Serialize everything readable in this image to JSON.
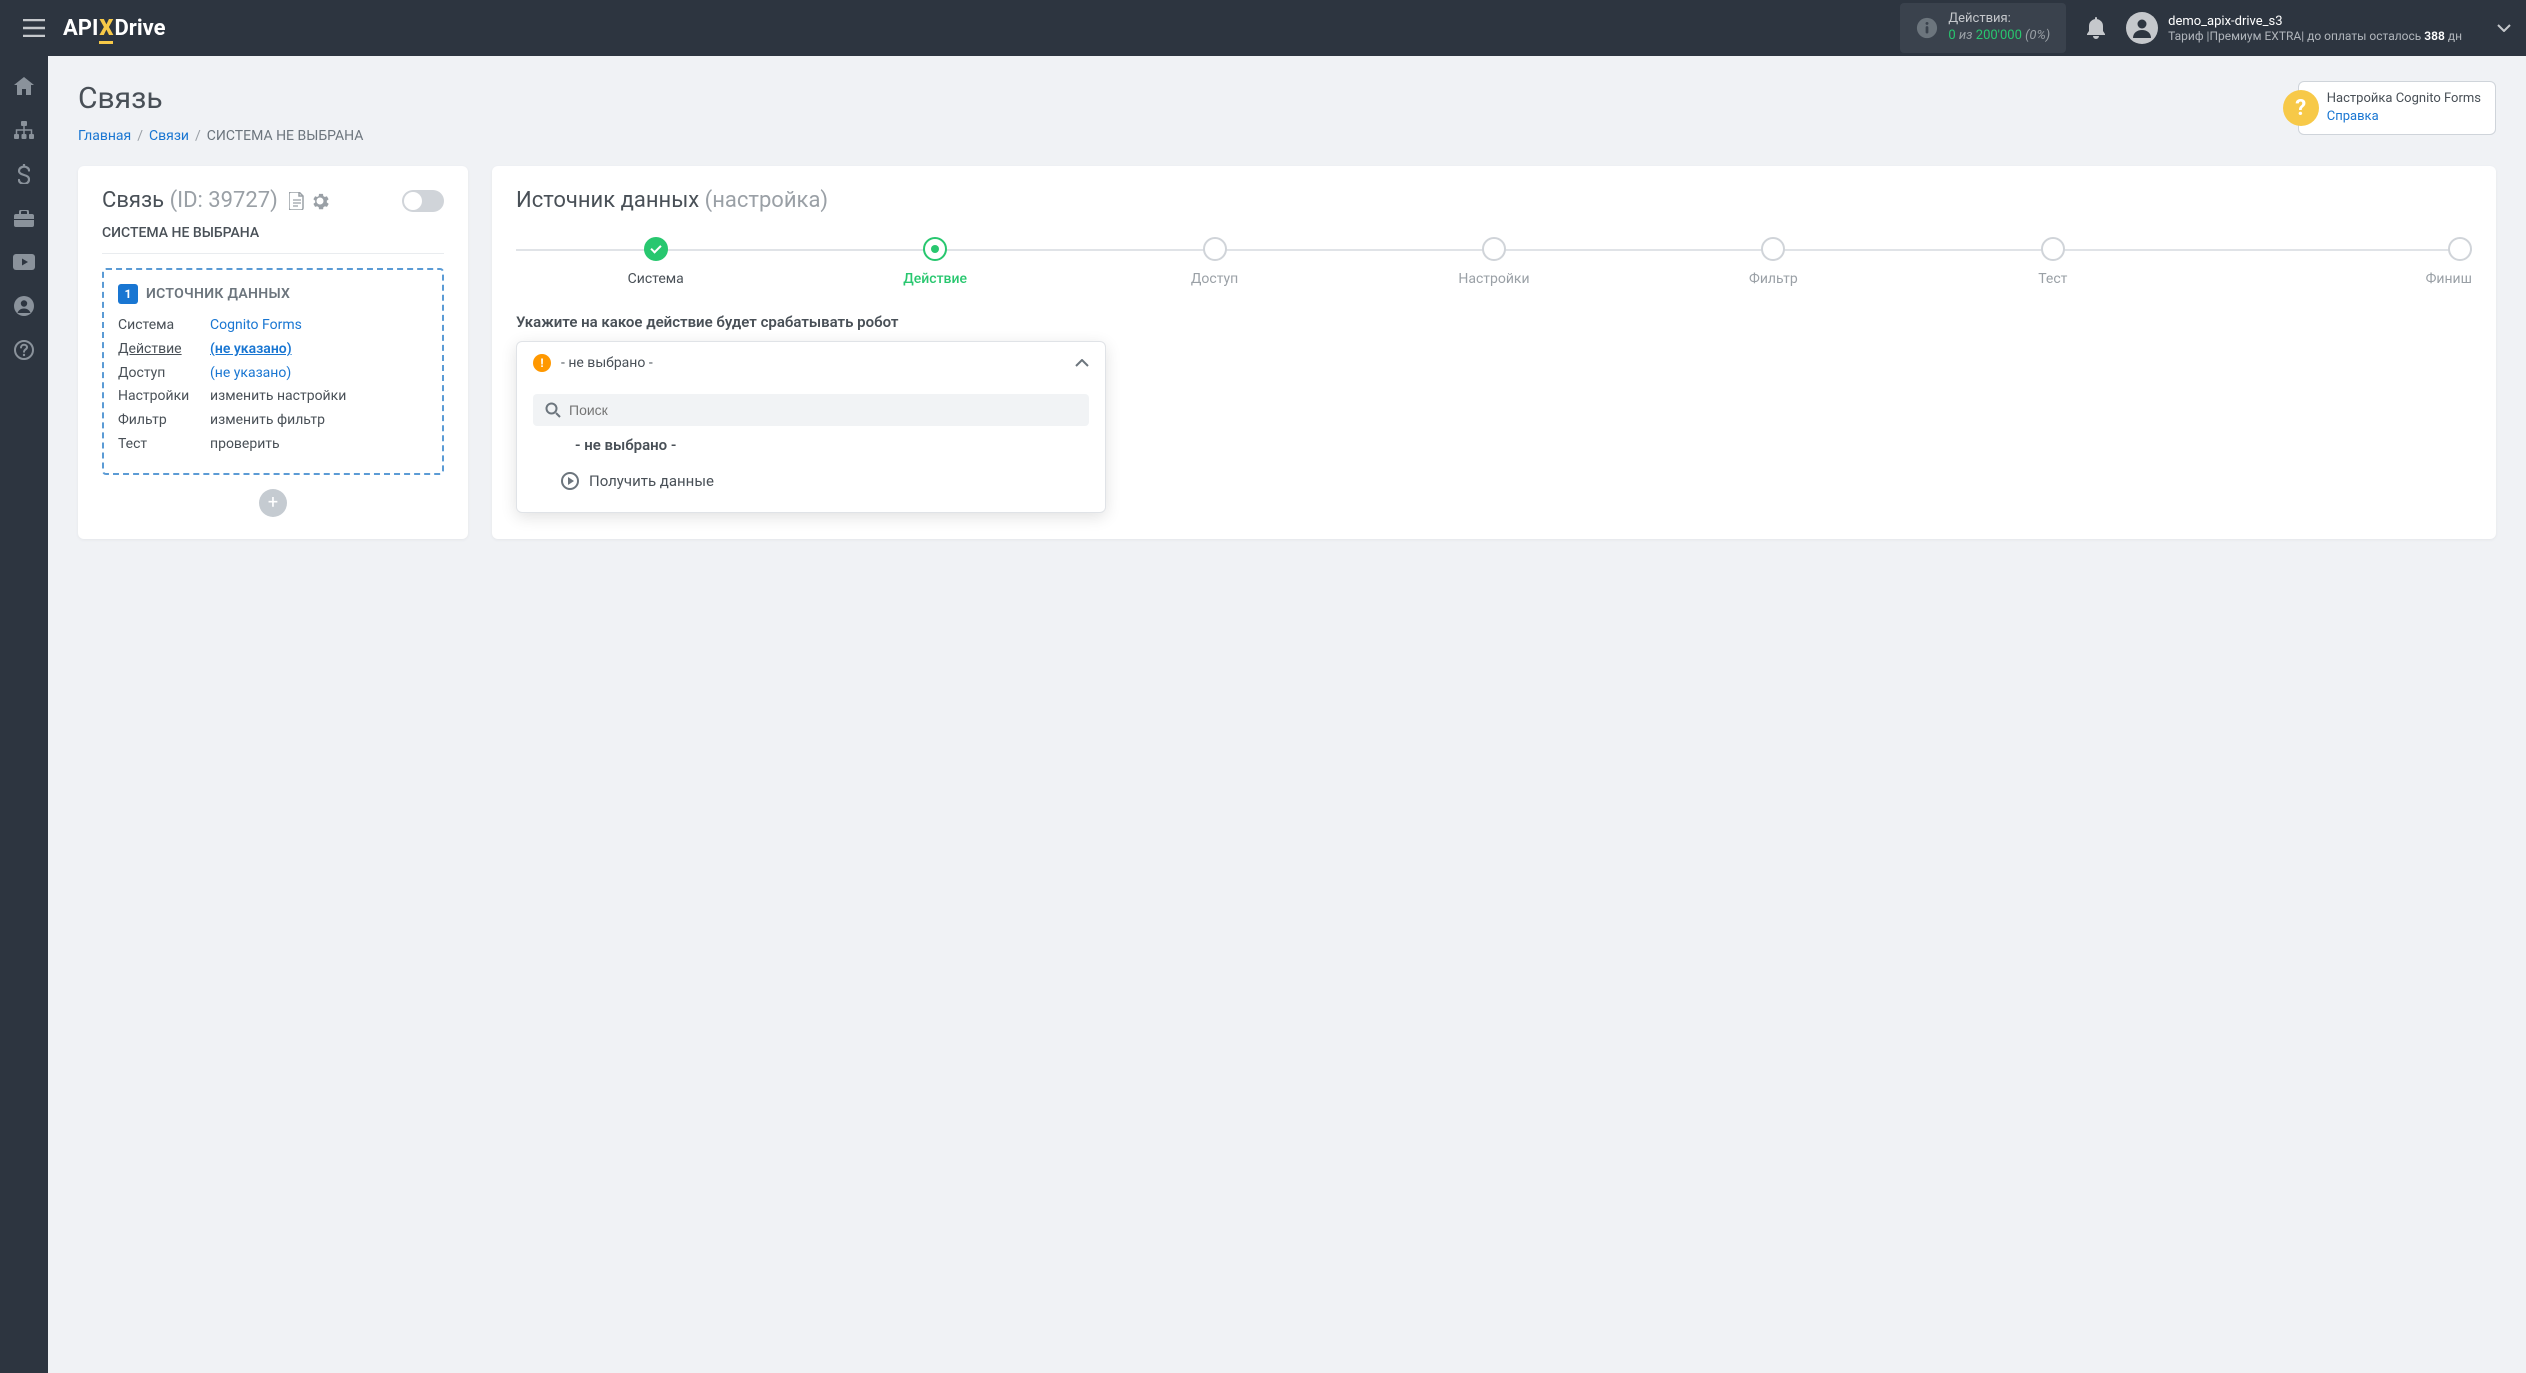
{
  "header": {
    "logo": {
      "api": "API",
      "x": "X",
      "drive": "Drive"
    },
    "actions": {
      "label": "Действия:",
      "current": "0",
      "of": " из ",
      "limit": "200'000",
      "pct": "(0%)"
    },
    "user": {
      "name": "demo_apix-drive_s3",
      "tariff_prefix": "Тариф |Премиум EXTRA| до оплаты осталось ",
      "days": "388",
      "days_suffix": " дн"
    }
  },
  "page": {
    "title": "Связь",
    "breadcrumb": {
      "home": "Главная",
      "links": "Связи",
      "current": "СИСТЕМА НЕ ВЫБРАНА"
    },
    "help": {
      "title": "Настройка Cognito Forms",
      "link": "Справка"
    }
  },
  "left": {
    "title": "Связь",
    "id_label": "(ID: 39727)",
    "subtitle": "СИСТЕМА НЕ ВЫБРАНА",
    "source": {
      "badge": "1",
      "title": "ИСТОЧНИК ДАННЫХ",
      "rows": {
        "system_label": "Система",
        "system_value": "Cognito Forms",
        "action_label": "Действие",
        "action_value": "(не указано)",
        "access_label": "Доступ",
        "access_value": "(не указано)",
        "settings_label": "Настройки",
        "settings_value": "изменить настройки",
        "filter_label": "Фильтр",
        "filter_value": "изменить фильтр",
        "test_label": "Тест",
        "test_value": "проверить"
      }
    }
  },
  "right": {
    "title": "Источник данных",
    "title_sub": "(настройка)",
    "steps": [
      {
        "label": "Система",
        "state": "done"
      },
      {
        "label": "Действие",
        "state": "active"
      },
      {
        "label": "Доступ",
        "state": ""
      },
      {
        "label": "Настройки",
        "state": ""
      },
      {
        "label": "Фильтр",
        "state": ""
      },
      {
        "label": "Тест",
        "state": ""
      },
      {
        "label": "Финиш",
        "state": ""
      }
    ],
    "section_title": "Укажите на какое действие будет срабатывать робот",
    "dropdown": {
      "selected": "- не выбрано -",
      "search_placeholder": "Поиск",
      "option_placeholder": "- не выбрано -",
      "option_1": "Получить данные"
    }
  }
}
